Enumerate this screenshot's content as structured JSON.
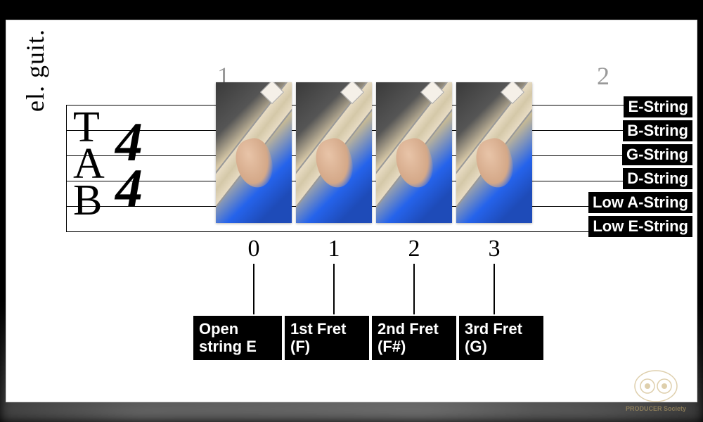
{
  "instrument_label": "el. guit.",
  "tab_letters": [
    "T",
    "A",
    "B"
  ],
  "time_signature": {
    "top": "4",
    "bottom": "4"
  },
  "bar_numbers": [
    "1",
    "2"
  ],
  "fret_numbers": [
    "0",
    "1",
    "2",
    "3"
  ],
  "fret_labels": [
    "Open string E",
    "1st Fret (F)",
    "2nd Fret (F#)",
    "3rd Fret (G)"
  ],
  "string_labels": [
    "E-String",
    "B-String",
    "G-String",
    "D-String",
    "Low A-String",
    "Low E-String"
  ],
  "logo_text": "PRODUCER Society"
}
